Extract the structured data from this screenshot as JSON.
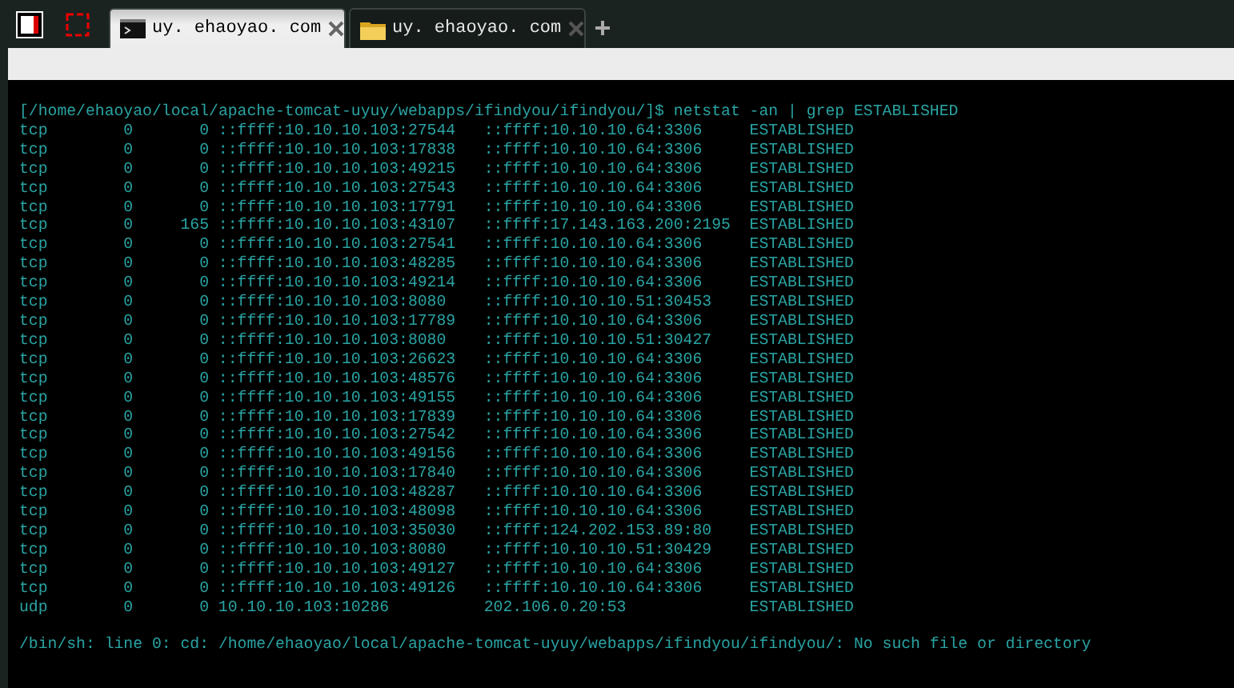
{
  "tabs": [
    {
      "kind": "terminal",
      "label": "uy. ehaoyao. com",
      "selected": true
    },
    {
      "kind": "folder",
      "label": "uy. ehaoyao. com",
      "selected": false
    }
  ],
  "terminal": {
    "command_line": "[/home/ehaoyao/local/apache-tomcat-uyuy/webapps/ifindyou/ifindyou/]$ netstat -an | grep ESTABLISHED",
    "rows": [
      {
        "proto": "tcp",
        "recv_q": "0",
        "send_q": "0",
        "local": "::ffff:10.10.10.103:27544",
        "foreign": "::ffff:10.10.10.64:3306",
        "state": "ESTABLISHED"
      },
      {
        "proto": "tcp",
        "recv_q": "0",
        "send_q": "0",
        "local": "::ffff:10.10.10.103:17838",
        "foreign": "::ffff:10.10.10.64:3306",
        "state": "ESTABLISHED"
      },
      {
        "proto": "tcp",
        "recv_q": "0",
        "send_q": "0",
        "local": "::ffff:10.10.10.103:49215",
        "foreign": "::ffff:10.10.10.64:3306",
        "state": "ESTABLISHED"
      },
      {
        "proto": "tcp",
        "recv_q": "0",
        "send_q": "0",
        "local": "::ffff:10.10.10.103:27543",
        "foreign": "::ffff:10.10.10.64:3306",
        "state": "ESTABLISHED"
      },
      {
        "proto": "tcp",
        "recv_q": "0",
        "send_q": "0",
        "local": "::ffff:10.10.10.103:17791",
        "foreign": "::ffff:10.10.10.64:3306",
        "state": "ESTABLISHED"
      },
      {
        "proto": "tcp",
        "recv_q": "0",
        "send_q": "165",
        "local": "::ffff:10.10.10.103:43107",
        "foreign": "::ffff:17.143.163.200:2195",
        "state": "ESTABLISHED"
      },
      {
        "proto": "tcp",
        "recv_q": "0",
        "send_q": "0",
        "local": "::ffff:10.10.10.103:27541",
        "foreign": "::ffff:10.10.10.64:3306",
        "state": "ESTABLISHED"
      },
      {
        "proto": "tcp",
        "recv_q": "0",
        "send_q": "0",
        "local": "::ffff:10.10.10.103:48285",
        "foreign": "::ffff:10.10.10.64:3306",
        "state": "ESTABLISHED"
      },
      {
        "proto": "tcp",
        "recv_q": "0",
        "send_q": "0",
        "local": "::ffff:10.10.10.103:49214",
        "foreign": "::ffff:10.10.10.64:3306",
        "state": "ESTABLISHED"
      },
      {
        "proto": "tcp",
        "recv_q": "0",
        "send_q": "0",
        "local": "::ffff:10.10.10.103:8080",
        "foreign": "::ffff:10.10.10.51:30453",
        "state": "ESTABLISHED"
      },
      {
        "proto": "tcp",
        "recv_q": "0",
        "send_q": "0",
        "local": "::ffff:10.10.10.103:17789",
        "foreign": "::ffff:10.10.10.64:3306",
        "state": "ESTABLISHED"
      },
      {
        "proto": "tcp",
        "recv_q": "0",
        "send_q": "0",
        "local": "::ffff:10.10.10.103:8080",
        "foreign": "::ffff:10.10.10.51:30427",
        "state": "ESTABLISHED"
      },
      {
        "proto": "tcp",
        "recv_q": "0",
        "send_q": "0",
        "local": "::ffff:10.10.10.103:26623",
        "foreign": "::ffff:10.10.10.64:3306",
        "state": "ESTABLISHED"
      },
      {
        "proto": "tcp",
        "recv_q": "0",
        "send_q": "0",
        "local": "::ffff:10.10.10.103:48576",
        "foreign": "::ffff:10.10.10.64:3306",
        "state": "ESTABLISHED"
      },
      {
        "proto": "tcp",
        "recv_q": "0",
        "send_q": "0",
        "local": "::ffff:10.10.10.103:49155",
        "foreign": "::ffff:10.10.10.64:3306",
        "state": "ESTABLISHED"
      },
      {
        "proto": "tcp",
        "recv_q": "0",
        "send_q": "0",
        "local": "::ffff:10.10.10.103:17839",
        "foreign": "::ffff:10.10.10.64:3306",
        "state": "ESTABLISHED"
      },
      {
        "proto": "tcp",
        "recv_q": "0",
        "send_q": "0",
        "local": "::ffff:10.10.10.103:27542",
        "foreign": "::ffff:10.10.10.64:3306",
        "state": "ESTABLISHED"
      },
      {
        "proto": "tcp",
        "recv_q": "0",
        "send_q": "0",
        "local": "::ffff:10.10.10.103:49156",
        "foreign": "::ffff:10.10.10.64:3306",
        "state": "ESTABLISHED"
      },
      {
        "proto": "tcp",
        "recv_q": "0",
        "send_q": "0",
        "local": "::ffff:10.10.10.103:17840",
        "foreign": "::ffff:10.10.10.64:3306",
        "state": "ESTABLISHED"
      },
      {
        "proto": "tcp",
        "recv_q": "0",
        "send_q": "0",
        "local": "::ffff:10.10.10.103:48287",
        "foreign": "::ffff:10.10.10.64:3306",
        "state": "ESTABLISHED"
      },
      {
        "proto": "tcp",
        "recv_q": "0",
        "send_q": "0",
        "local": "::ffff:10.10.10.103:48098",
        "foreign": "::ffff:10.10.10.64:3306",
        "state": "ESTABLISHED"
      },
      {
        "proto": "tcp",
        "recv_q": "0",
        "send_q": "0",
        "local": "::ffff:10.10.10.103:35030",
        "foreign": "::ffff:124.202.153.89:80",
        "state": "ESTABLISHED"
      },
      {
        "proto": "tcp",
        "recv_q": "0",
        "send_q": "0",
        "local": "::ffff:10.10.10.103:8080",
        "foreign": "::ffff:10.10.10.51:30429",
        "state": "ESTABLISHED"
      },
      {
        "proto": "tcp",
        "recv_q": "0",
        "send_q": "0",
        "local": "::ffff:10.10.10.103:49127",
        "foreign": "::ffff:10.10.10.64:3306",
        "state": "ESTABLISHED"
      },
      {
        "proto": "tcp",
        "recv_q": "0",
        "send_q": "0",
        "local": "::ffff:10.10.10.103:49126",
        "foreign": "::ffff:10.10.10.64:3306",
        "state": "ESTABLISHED"
      },
      {
        "proto": "udp",
        "recv_q": "0",
        "send_q": "0",
        "local": "10.10.10.103:10286",
        "foreign": "202.106.0.20:53",
        "state": "ESTABLISHED"
      }
    ],
    "error_line": "/bin/sh: line 0: cd: /home/ehaoyao/local/apache-tomcat-uyuy/webapps/ifindyou/ifindyou/: No such file or directory"
  }
}
